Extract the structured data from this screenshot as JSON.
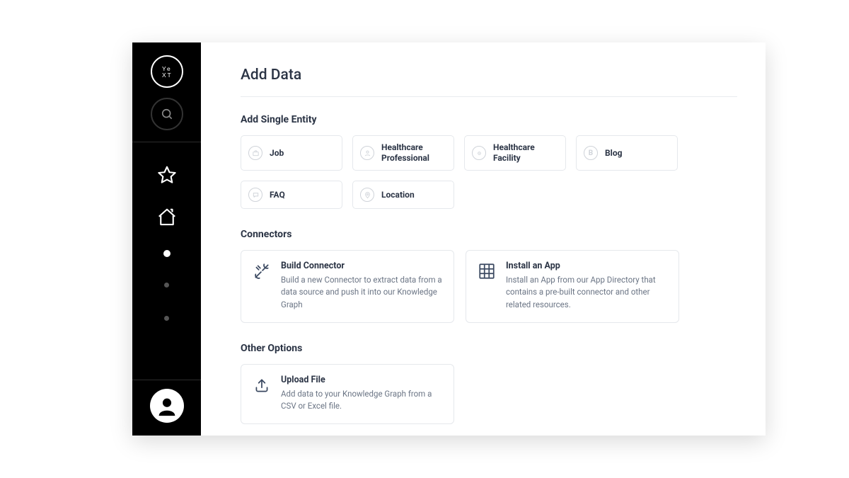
{
  "page": {
    "title": "Add Data"
  },
  "sections": {
    "single_entity": {
      "heading": "Add Single Entity",
      "items": [
        {
          "label": "Job"
        },
        {
          "label": "Healthcare Professional"
        },
        {
          "label": "Healthcare Facility"
        },
        {
          "label": "Blog",
          "badge": "B"
        },
        {
          "label": "FAQ"
        },
        {
          "label": "Location"
        }
      ]
    },
    "connectors": {
      "heading": "Connectors",
      "items": [
        {
          "title": "Build Connector",
          "desc": "Build a new Connector to extract data from a data source and push it into our Knowledge Graph"
        },
        {
          "title": "Install an App",
          "desc": "Install an App from our App Directory that contains a pre-built connector and other related resources."
        }
      ]
    },
    "other": {
      "heading": "Other Options",
      "items": [
        {
          "title": "Upload File",
          "desc": "Add data to your Knowledge Graph from a CSV or Excel file."
        }
      ]
    }
  }
}
